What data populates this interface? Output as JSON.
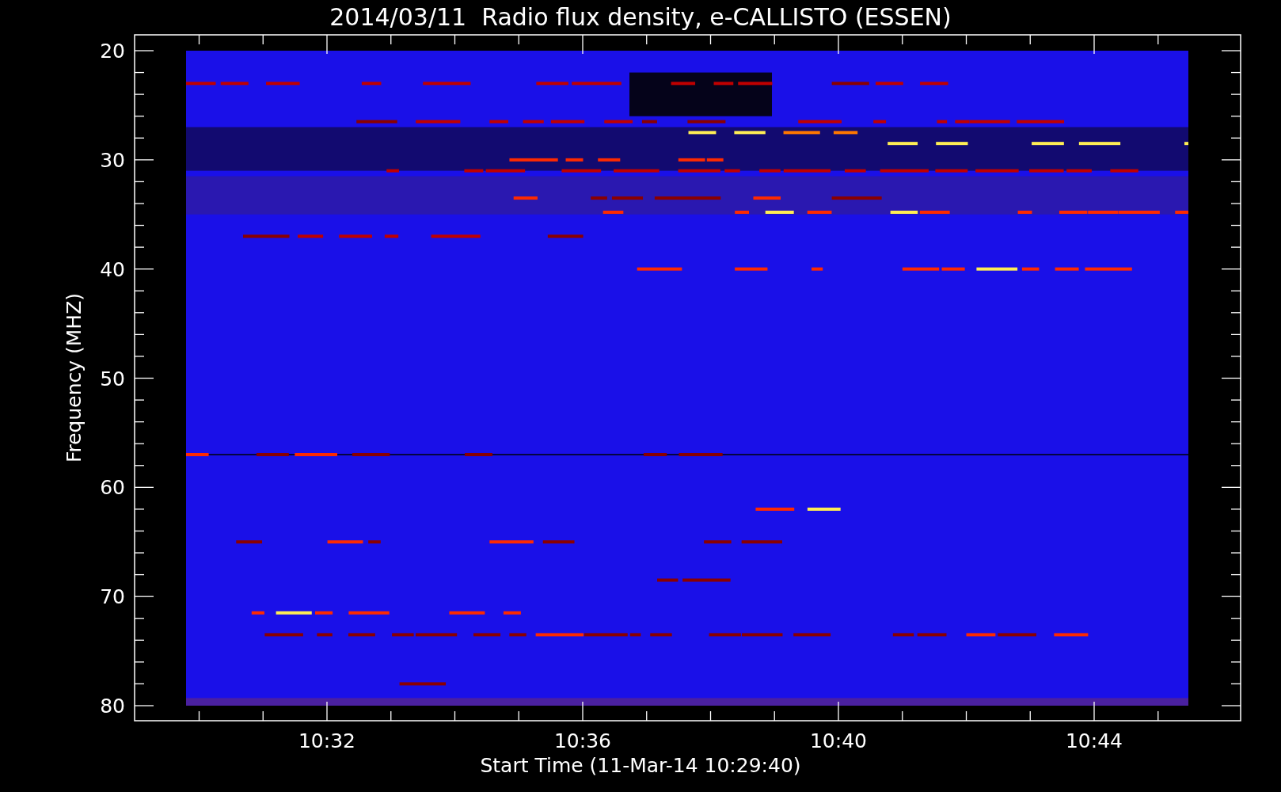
{
  "title": "2014/03/11  Radio flux density, e-CALLISTO (ESSEN)",
  "y_axis": {
    "label": "Frequency (MHZ)",
    "ticks": [
      "20",
      "30",
      "40",
      "50",
      "60",
      "70",
      "80"
    ]
  },
  "x_axis": {
    "label": "Start Time (11-Mar-14 10:29:40)",
    "ticks": [
      "10:32",
      "10:36",
      "10:40",
      "10:44"
    ]
  }
}
